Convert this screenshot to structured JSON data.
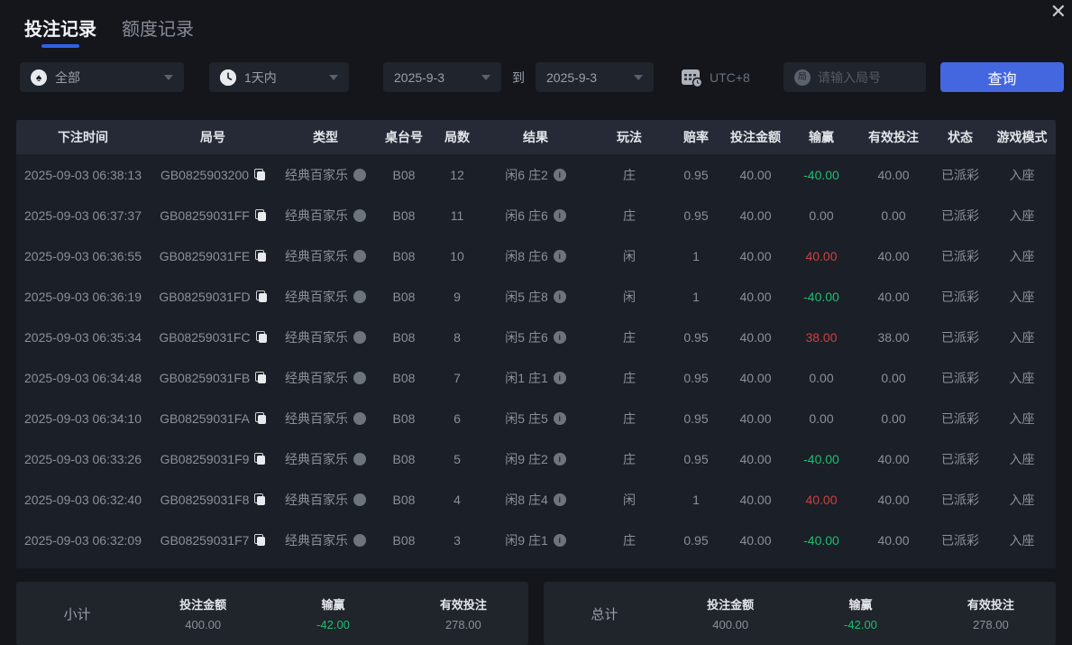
{
  "window": {
    "close_icon": "✕"
  },
  "tabs": [
    {
      "label": "投注记录",
      "active": true
    },
    {
      "label": "额度记录",
      "active": false
    }
  ],
  "filters": {
    "game_type": {
      "value": "全部",
      "icon": "spade",
      "icon_glyph": "♠"
    },
    "time_range": {
      "value": "1天内",
      "icon": "clock"
    },
    "date_from": "2025-9-3",
    "to_label": "到",
    "date_to": "2025-9-3",
    "timezone": "UTC+8",
    "round_input": {
      "placeholder": "请输入局号",
      "icon_glyph": "局"
    },
    "query_button": "查询"
  },
  "table": {
    "headers": [
      "下注时间",
      "局号",
      "类型",
      "桌台号",
      "局数",
      "结果",
      "玩法",
      "赔率",
      "投注金额",
      "输赢",
      "有效投注",
      "状态",
      "游戏模式"
    ],
    "rows": [
      {
        "time": "2025-09-03 06:38:13",
        "round": "GB0825903200",
        "type": "经典百家乐",
        "table_no": "B08",
        "game_no": "12",
        "result": "闲6 庄2",
        "play": "庄",
        "odds": "0.95",
        "bet": "40.00",
        "win": "-40.00",
        "win_color": "green",
        "valid": "40.00",
        "status": "已派彩",
        "mode": "入座"
      },
      {
        "time": "2025-09-03 06:37:37",
        "round": "GB08259031FF",
        "type": "经典百家乐",
        "table_no": "B08",
        "game_no": "11",
        "result": "闲6 庄6",
        "play": "庄",
        "odds": "0.95",
        "bet": "40.00",
        "win": "0.00",
        "win_color": "gray",
        "valid": "0.00",
        "status": "已派彩",
        "mode": "入座"
      },
      {
        "time": "2025-09-03 06:36:55",
        "round": "GB08259031FE",
        "type": "经典百家乐",
        "table_no": "B08",
        "game_no": "10",
        "result": "闲8 庄6",
        "play": "闲",
        "odds": "1",
        "bet": "40.00",
        "win": "40.00",
        "win_color": "red",
        "valid": "40.00",
        "status": "已派彩",
        "mode": "入座"
      },
      {
        "time": "2025-09-03 06:36:19",
        "round": "GB08259031FD",
        "type": "经典百家乐",
        "table_no": "B08",
        "game_no": "9",
        "result": "闲5 庄8",
        "play": "闲",
        "odds": "1",
        "bet": "40.00",
        "win": "-40.00",
        "win_color": "green",
        "valid": "40.00",
        "status": "已派彩",
        "mode": "入座"
      },
      {
        "time": "2025-09-03 06:35:34",
        "round": "GB08259031FC",
        "type": "经典百家乐",
        "table_no": "B08",
        "game_no": "8",
        "result": "闲5 庄6",
        "play": "庄",
        "odds": "0.95",
        "bet": "40.00",
        "win": "38.00",
        "win_color": "red",
        "valid": "38.00",
        "status": "已派彩",
        "mode": "入座"
      },
      {
        "time": "2025-09-03 06:34:48",
        "round": "GB08259031FB",
        "type": "经典百家乐",
        "table_no": "B08",
        "game_no": "7",
        "result": "闲1 庄1",
        "play": "庄",
        "odds": "0.95",
        "bet": "40.00",
        "win": "0.00",
        "win_color": "gray",
        "valid": "0.00",
        "status": "已派彩",
        "mode": "入座"
      },
      {
        "time": "2025-09-03 06:34:10",
        "round": "GB08259031FA",
        "type": "经典百家乐",
        "table_no": "B08",
        "game_no": "6",
        "result": "闲5 庄5",
        "play": "庄",
        "odds": "0.95",
        "bet": "40.00",
        "win": "0.00",
        "win_color": "gray",
        "valid": "0.00",
        "status": "已派彩",
        "mode": "入座"
      },
      {
        "time": "2025-09-03 06:33:26",
        "round": "GB08259031F9",
        "type": "经典百家乐",
        "table_no": "B08",
        "game_no": "5",
        "result": "闲9 庄2",
        "play": "庄",
        "odds": "0.95",
        "bet": "40.00",
        "win": "-40.00",
        "win_color": "green",
        "valid": "40.00",
        "status": "已派彩",
        "mode": "入座"
      },
      {
        "time": "2025-09-03 06:32:40",
        "round": "GB08259031F8",
        "type": "经典百家乐",
        "table_no": "B08",
        "game_no": "4",
        "result": "闲8 庄4",
        "play": "闲",
        "odds": "1",
        "bet": "40.00",
        "win": "40.00",
        "win_color": "red",
        "valid": "40.00",
        "status": "已派彩",
        "mode": "入座"
      },
      {
        "time": "2025-09-03 06:32:09",
        "round": "GB08259031F7",
        "type": "经典百家乐",
        "table_no": "B08",
        "game_no": "3",
        "result": "闲9 庄1",
        "play": "庄",
        "odds": "0.95",
        "bet": "40.00",
        "win": "-40.00",
        "win_color": "green",
        "valid": "40.00",
        "status": "已派彩",
        "mode": "入座"
      }
    ]
  },
  "summary": {
    "bet_label": "投注金额",
    "win_label": "输赢",
    "valid_label": "有效投注",
    "subtotal": {
      "label": "小计",
      "bet": "400.00",
      "win": "-42.00",
      "valid": "278.00"
    },
    "total": {
      "label": "总计",
      "bet": "400.00",
      "win": "-42.00",
      "valid": "278.00"
    }
  },
  "colors": {
    "accent_blue": "#4467e0",
    "win_green": "#1fbe71",
    "win_red": "#cf4040",
    "background": "#14161c"
  }
}
